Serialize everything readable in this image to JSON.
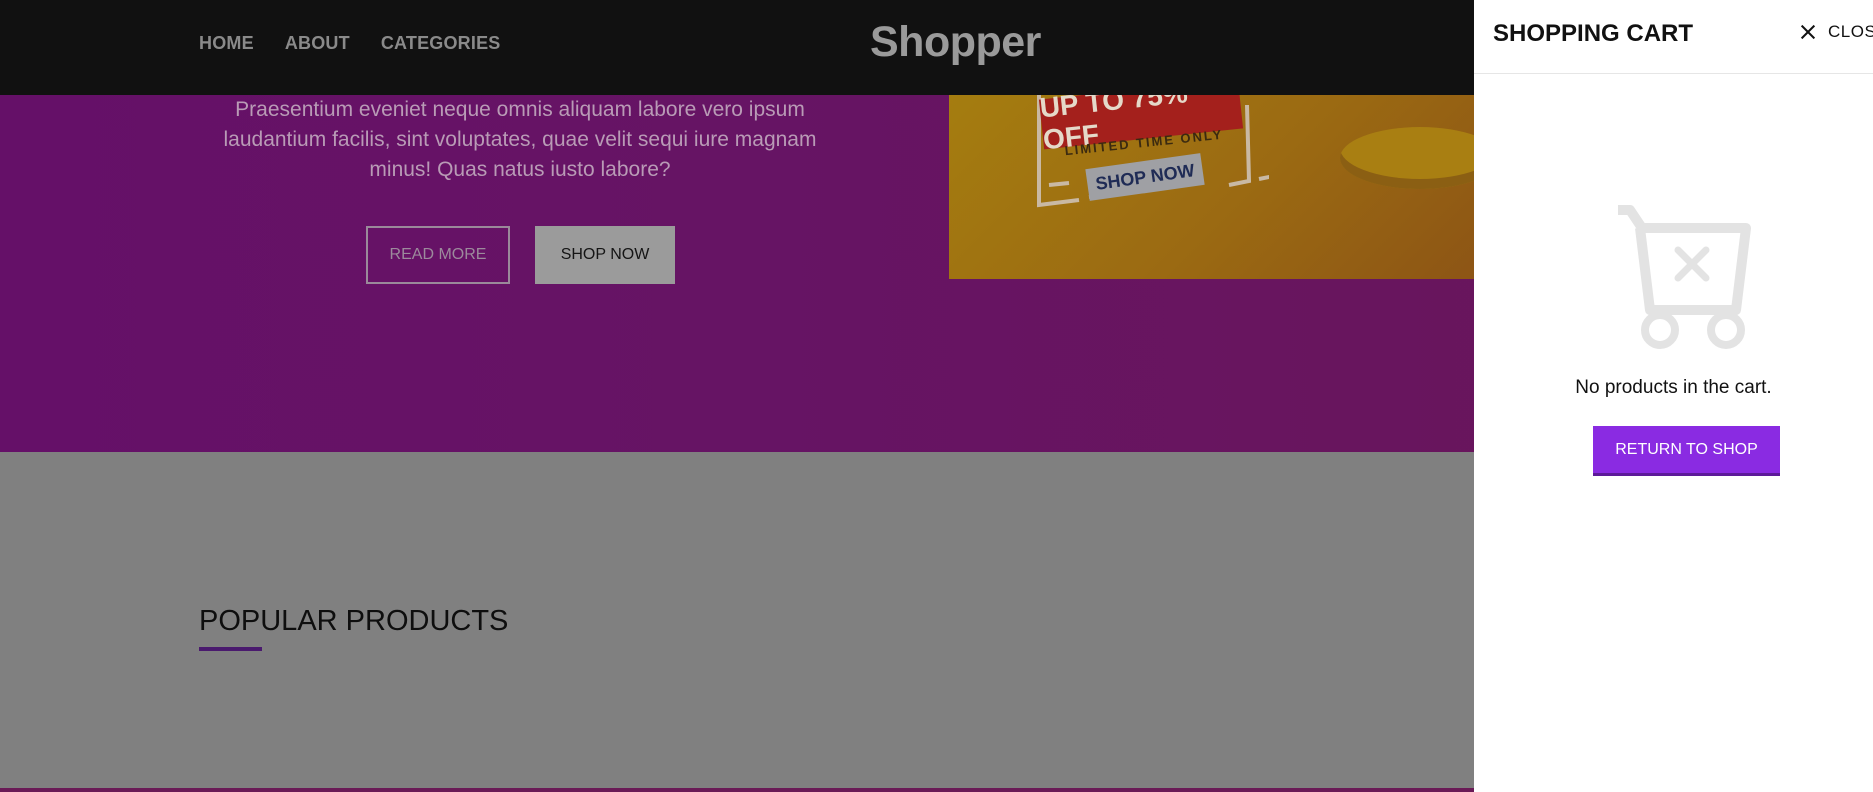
{
  "header": {
    "nav": [
      "HOME",
      "ABOUT",
      "CATEGORIES"
    ],
    "brand": "Shopper"
  },
  "hero": {
    "text": "Praesentium eveniet neque omnis aliquam labore vero ipsum laudantium facilis, sint voluptates, quae velit sequi iure magnam minus! Quas natus iusto labore?",
    "read_more_label": "READ MORE",
    "shop_now_label": "SHOP NOW"
  },
  "promo": {
    "headline": "UP TO 75% OFF",
    "subline": "LIMITED TIME ONLY",
    "button": "SHOP NOW"
  },
  "section": {
    "title": "POPULAR PRODUCTS"
  },
  "drawer": {
    "title": "SHOPPING CART",
    "close_label": "CLOSE",
    "empty_message": "No products in the cart.",
    "return_label": "RETURN TO SHOP",
    "icon": "empty-cart-icon"
  },
  "colors": {
    "accent": "#8a2be2",
    "hero_purple": "#661464",
    "overlay_gray": "#808080",
    "topbar": "#111111"
  }
}
